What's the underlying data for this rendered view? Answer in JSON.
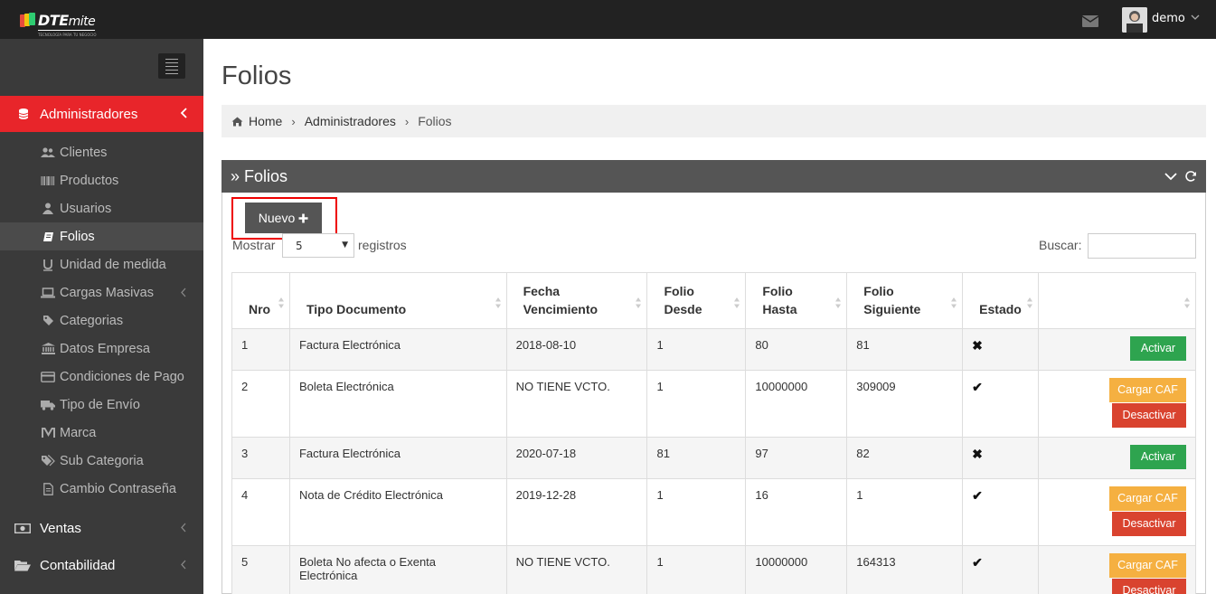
{
  "topbar": {
    "logo_text_bold": "DTE",
    "logo_text_light": "mite",
    "logo_subtext": "TECNOLOGÍA PARA TU NEGOCIO",
    "user_name": "demo"
  },
  "sidebar": {
    "active_section": "Administradores",
    "items": [
      {
        "label": "Clientes",
        "icon": "users-icon"
      },
      {
        "label": "Productos",
        "icon": "barcode-icon"
      },
      {
        "label": "Usuarios",
        "icon": "user-icon"
      },
      {
        "label": "Folios",
        "icon": "book-icon"
      },
      {
        "label": "Unidad de medida",
        "icon": "underline-icon"
      },
      {
        "label": "Cargas Masivas",
        "icon": "laptop-icon"
      },
      {
        "label": "Categorias",
        "icon": "tag-icon"
      },
      {
        "label": "Datos Empresa",
        "icon": "bank-icon"
      },
      {
        "label": "Condiciones de Pago",
        "icon": "credit-card-icon"
      },
      {
        "label": "Tipo de Envío",
        "icon": "truck-icon"
      },
      {
        "label": "Marca",
        "icon": "m-icon"
      },
      {
        "label": "Sub Categoria",
        "icon": "tags-icon"
      },
      {
        "label": "Cambio Contraseña",
        "icon": "file-icon"
      }
    ],
    "sections": [
      {
        "label": "Ventas",
        "icon": "money-icon"
      },
      {
        "label": "Contabilidad",
        "icon": "folder-open-icon"
      }
    ]
  },
  "page": {
    "title": "Folios",
    "breadcrumb": [
      "Home",
      "Administradores",
      "Folios"
    ]
  },
  "panel": {
    "title": "» Folios",
    "new_button": "Nuevo",
    "show_label": "Mostrar",
    "page_length": "5",
    "records_label": "registros",
    "search_label": "Buscar:",
    "search_value": ""
  },
  "table": {
    "headers": [
      "Nro",
      "Tipo Documento",
      "Fecha Vencimiento",
      "Folio Desde",
      "Folio Hasta",
      "Folio Siguiente",
      "Estado",
      ""
    ],
    "rows": [
      {
        "nro": "1",
        "tipo": "Factura Electrónica",
        "vencimiento": "2018-08-10",
        "desde": "1",
        "hasta": "80",
        "siguiente": "81",
        "estado": "✖",
        "actions": [
          "Activar"
        ]
      },
      {
        "nro": "2",
        "tipo": "Boleta Electrónica",
        "vencimiento": "NO TIENE VCTO.",
        "desde": "1",
        "hasta": "10000000",
        "siguiente": "309009",
        "estado": "✔",
        "actions": [
          "Cargar CAF",
          "Desactivar"
        ]
      },
      {
        "nro": "3",
        "tipo": "Factura Electrónica",
        "vencimiento": "2020-07-18",
        "desde": "81",
        "hasta": "97",
        "siguiente": "82",
        "estado": "✖",
        "actions": [
          "Activar"
        ]
      },
      {
        "nro": "4",
        "tipo": "Nota de Crédito Electrónica",
        "vencimiento": "2019-12-28",
        "desde": "1",
        "hasta": "16",
        "siguiente": "1",
        "estado": "✔",
        "actions": [
          "Cargar CAF",
          "Desactivar"
        ]
      },
      {
        "nro": "5",
        "tipo": "Boleta No afecta o Exenta Electrónica",
        "vencimiento": "NO TIENE VCTO.",
        "desde": "1",
        "hasta": "10000000",
        "siguiente": "164313",
        "estado": "✔",
        "actions": [
          "Cargar CAF",
          "Desactivar"
        ]
      }
    ]
  },
  "colors": {
    "topbar": "#222222",
    "sidebar": "#3a3a3a",
    "accent": "#e8252a",
    "activate": "#2ea44f",
    "cargar": "#f5b041",
    "desactivar": "#d9432f"
  }
}
